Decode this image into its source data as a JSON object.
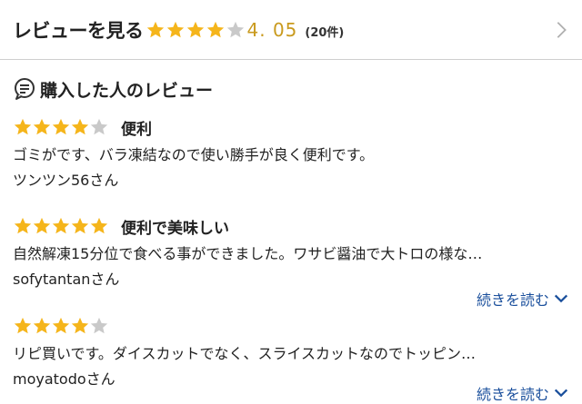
{
  "header": {
    "title": "レビューを見る",
    "rating_text": "4. 05",
    "count_text": "(20件)",
    "rating_value": 4.05
  },
  "section": {
    "title": "購入した人のレビュー"
  },
  "reviews": [
    {
      "stars": 4,
      "title": "便利",
      "body": "ゴミがです、バラ凍結なので使い勝手が良く便利です。",
      "author": "ツンツン56さん",
      "read_more": ""
    },
    {
      "stars": 5,
      "title": "便利で美味しい",
      "body": "自然解凍15分位で食べる事ができました。ワサビ醤油で大トロの様な…",
      "author": "sofytantanさん",
      "read_more": "続きを読む"
    },
    {
      "stars": 4,
      "title": "",
      "body": "リピ買いです。ダイスカットでなく、スライスカットなのでトッピン…",
      "author": "moyatodoさん",
      "read_more": "続きを読む"
    }
  ],
  "colors": {
    "star_on": "#f5b51b",
    "star_off": "#c9c9c9",
    "link": "#1a4f9c",
    "rating": "#c99a1e"
  },
  "icons": {
    "header_chevron": "chevron-right-icon",
    "section": "chat-bubble-icon",
    "read_more": "chevron-down-icon"
  }
}
